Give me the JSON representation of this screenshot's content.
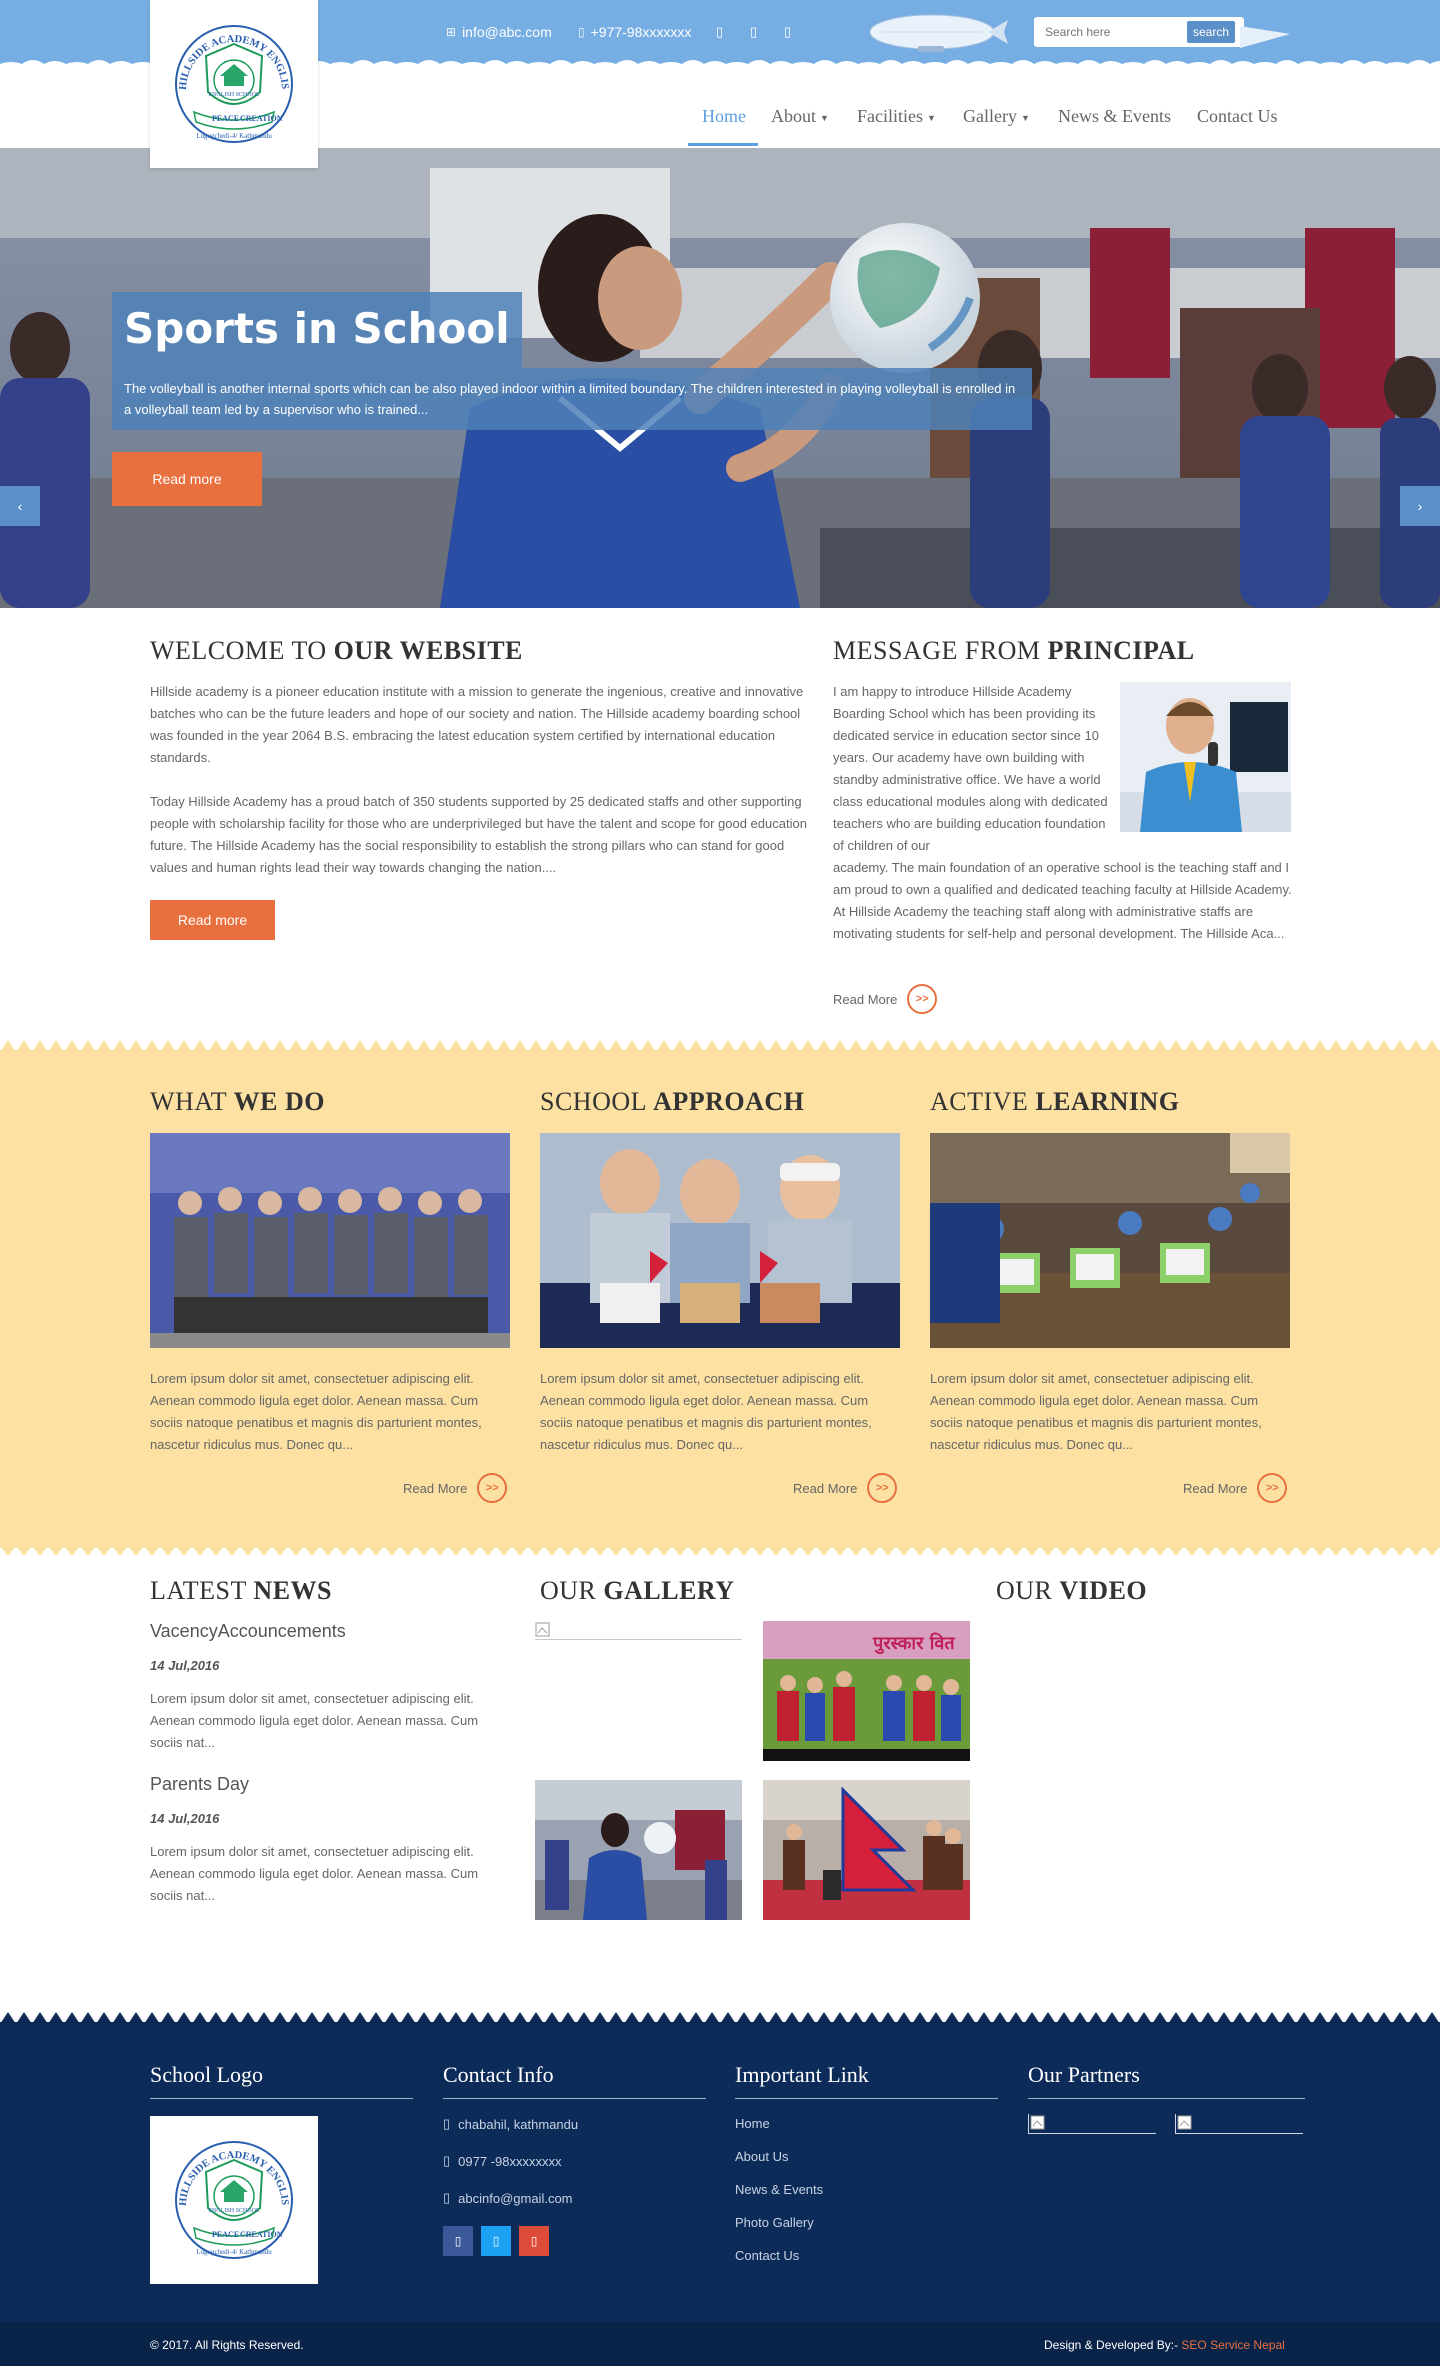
{
  "header": {
    "email": "info@abc.com",
    "phone": "+977-98xxxxxxx",
    "search_placeholder": "Search here",
    "search_button": "search",
    "logo": {
      "arc_text": "HILLSIDE ACADEMY ENGLISH SCHOOL",
      "center_text": "ENGLISH SCHOOL",
      "ribbon_left": "PEACE",
      "ribbon_right": "CREATION",
      "bottom_text": "Lugugchedi-4/ Kathmandu"
    }
  },
  "nav": {
    "home": "Home",
    "about": "About",
    "facilities": "Facilities",
    "gallery": "Gallery",
    "news": "News & Events",
    "contact": "Contact Us"
  },
  "hero": {
    "title": "Sports in School",
    "description": "The volleyball is another internal sports which can be also played indoor within a limited boundary. The children interested in playing volleyball is enrolled in a volleyball team led by a supervisor who is trained...",
    "button": "Read more"
  },
  "welcome": {
    "title_light": "WELCOME TO ",
    "title_bold": "OUR WEBSITE",
    "para1": "Hillside academy is a pioneer education institute with a mission to generate the ingenious, creative and innovative batches who can be the future leaders and hope of our society and nation. The Hillside academy boarding school was founded in the year 2064 B.S. embracing the latest education system certified by international education standards.",
    "para2": "Today Hillside Academy has a proud batch of 350 students supported by 25 dedicated staffs and other supporting people with scholarship facility for those who are underprivileged but have the talent and scope for good education future. The Hillside Academy has the social responsibility to establish the strong pillars who can stand for good values and human rights lead their way towards changing the nation....",
    "button": "Read more"
  },
  "principal": {
    "title_light": "MESSAGE FROM ",
    "title_bold": "PRINCIPAL",
    "text_narrow": "I am happy to introduce Hillside Academy Boarding School which has been providing its dedicated service in education sector since 10 years. Our academy have own building with standby administrative office. We have a world class educational modules along with dedicated teachers who are building education foundation of children of our",
    "text_wide": "academy. The main foundation of an operative school is the teaching staff and I am proud to own a qualified and dedicated teaching faculty at Hillside Academy. At Hillside Academy the teaching staff along with administrative staffs are motivating students for self-help and personal development. The Hillside Aca...",
    "read_more": "Read More",
    "read_more_icon": ">>"
  },
  "features": [
    {
      "title_light": "WHAT ",
      "title_bold": "WE DO",
      "text": "Lorem ipsum dolor sit amet, consectetuer adipiscing elit. Aenean commodo ligula eget dolor. Aenean massa. Cum sociis natoque penatibus et magnis dis parturient montes, nascetur ridiculus mus. Donec qu...",
      "read_more": "Read More"
    },
    {
      "title_light": "SCHOOL ",
      "title_bold": "APPROACH",
      "text": "Lorem ipsum dolor sit amet, consectetuer adipiscing elit. Aenean commodo ligula eget dolor. Aenean massa. Cum sociis natoque penatibus et magnis dis parturient montes, nascetur ridiculus mus. Donec qu...",
      "read_more": "Read More"
    },
    {
      "title_light": "ACTIVE ",
      "title_bold": "LEARNING",
      "text": "Lorem ipsum dolor sit amet, consectetuer adipiscing elit. Aenean commodo ligula eget dolor. Aenean massa. Cum sociis natoque penatibus et magnis dis parturient montes, nascetur ridiculus mus. Donec qu...",
      "read_more": "Read More"
    }
  ],
  "news": {
    "title_light": "LATEST ",
    "title_bold": "NEWS",
    "items": [
      {
        "heading": "VacencyAccouncements",
        "date": "14 Jul,2016",
        "text": "Lorem ipsum dolor sit amet, consectetuer adipiscing elit. Aenean commodo ligula eget dolor. Aenean massa. Cum sociis nat..."
      },
      {
        "heading": "Parents Day",
        "date": "14 Jul,2016",
        "text": "Lorem ipsum dolor sit amet, consectetuer adipiscing elit. Aenean commodo ligula eget dolor. Aenean massa. Cum sociis nat..."
      }
    ]
  },
  "gallery": {
    "title_light": "OUR ",
    "title_bold": "GALLERY",
    "banner_text": "पुरस्कार वित"
  },
  "video": {
    "title_light": "OUR ",
    "title_bold": "VIDEO"
  },
  "footer": {
    "logo_title": "School Logo",
    "contact_title": "Contact Info",
    "address": "chabahil, kathmandu",
    "phone": "0977 -98xxxxxxxx",
    "email": "abcinfo@gmail.com",
    "links_title": "Important Link",
    "links": [
      "Home",
      "About Us",
      "News & Events",
      "Photo Gallery",
      "Contact Us"
    ],
    "partners_title": "Our Partners",
    "copyright": "© 2017. All Rights Reserved.",
    "credit_prefix": "Design & Developed By:- ",
    "credit_name": "SEO Service Nepal"
  },
  "colors": {
    "topbar": "#76aee3",
    "accent_orange": "#e8703e",
    "nav_active": "#5b9fe0",
    "band": "#fce1a2",
    "footer": "#0d2b58"
  }
}
